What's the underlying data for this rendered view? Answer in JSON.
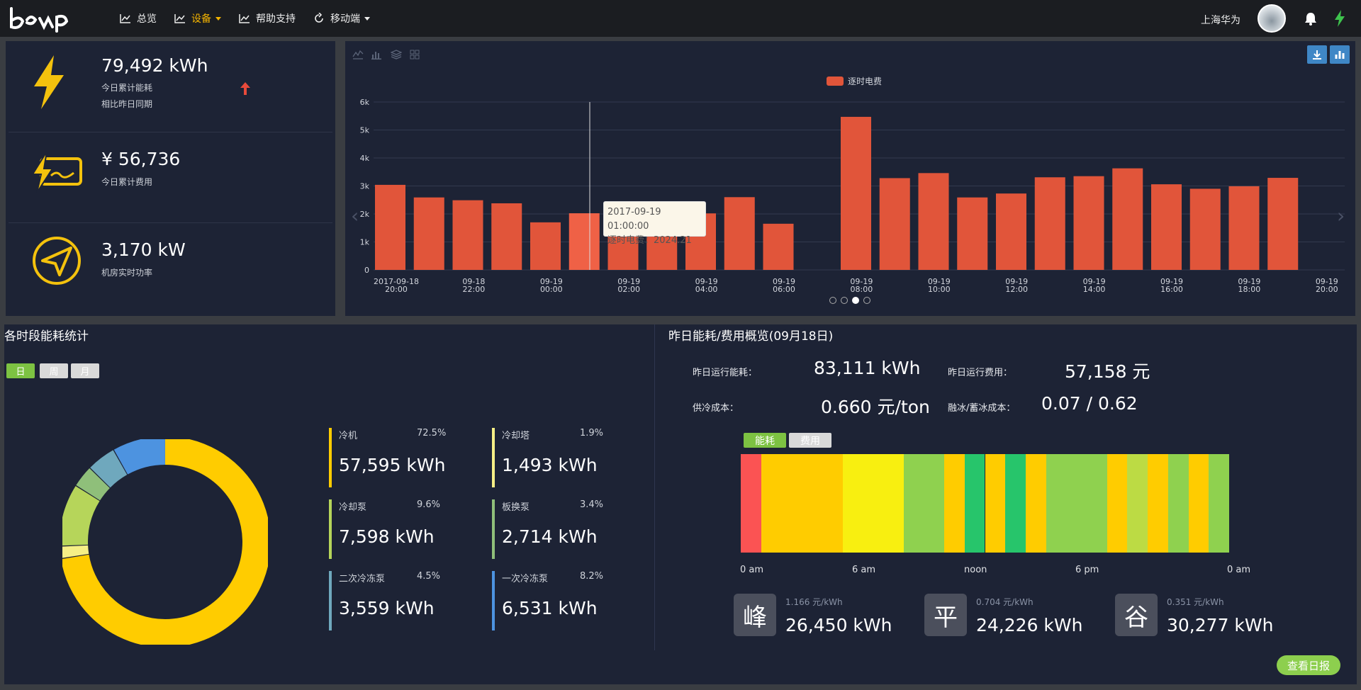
{
  "header": {
    "nav": [
      {
        "label": "总览"
      },
      {
        "label": "设备"
      },
      {
        "label": "帮助支持"
      },
      {
        "label": "移动端"
      }
    ],
    "user_name": "上海华为"
  },
  "kpis": [
    {
      "value": "79,492 kWh",
      "label": "今日累计能耗",
      "sublabel": "相比昨日同期"
    },
    {
      "value": "¥ 56,736",
      "label": "今日累计费用"
    },
    {
      "value": "3,170 kW",
      "label": "机房实时功率"
    }
  ],
  "colors": {
    "accent": "#f4b400",
    "bar": "#e1553a",
    "panel": "#1d2335",
    "green": "#8dcf4e"
  },
  "chart_data": {
    "type": "bar",
    "legend": "逐时电费",
    "y_ticks": [
      "0",
      "1k",
      "2k",
      "3k",
      "4k",
      "5k",
      "6k"
    ],
    "ylim": [
      0,
      6000
    ],
    "x_labels": [
      [
        "2017-09-18",
        "20:00"
      ],
      [
        "09-18",
        "22:00"
      ],
      [
        "09-19",
        "00:00"
      ],
      [
        "09-19",
        "02:00"
      ],
      [
        "09-19",
        "04:00"
      ],
      [
        "09-19",
        "06:00"
      ],
      [
        "09-19",
        "08:00"
      ],
      [
        "09-19",
        "10:00"
      ],
      [
        "09-19",
        "12:00"
      ],
      [
        "09-19",
        "14:00"
      ],
      [
        "09-19",
        "16:00"
      ],
      [
        "09-19",
        "18:00"
      ],
      [
        "09-19",
        "20:00"
      ]
    ],
    "values": [
      3040,
      2590,
      2490,
      2380,
      1700,
      2024.21,
      1980,
      1960,
      2020,
      2600,
      1650,
      null,
      5470,
      3280,
      3460,
      2590,
      2730,
      3310,
      3350,
      3630,
      3060,
      2900,
      2990,
      3290
    ],
    "highlight_index": 5,
    "tooltip": {
      "title": "2017-09-19 01:00:00",
      "text": "逐时电费：2024.21"
    }
  },
  "energy_stats": {
    "title": "各时段能耗统计",
    "periods": [
      "日",
      "周",
      "月"
    ],
    "items": [
      {
        "name": "冷机",
        "pct": "72.5%",
        "value": "57,595 kWh",
        "color": "#ffcc00"
      },
      {
        "name": "冷却塔",
        "pct": "1.9%",
        "value": "1,493 kWh",
        "color": "#f6ef86"
      },
      {
        "name": "冷却泵",
        "pct": "9.6%",
        "value": "7,598 kWh",
        "color": "#b6d55a"
      },
      {
        "name": "板换泵",
        "pct": "3.4%",
        "value": "2,714 kWh",
        "color": "#8fbf7a"
      },
      {
        "name": "二次冷冻泵",
        "pct": "4.5%",
        "value": "3,559 kWh",
        "color": "#6fa8bd"
      },
      {
        "name": "一次冷冻泵",
        "pct": "8.2%",
        "value": "6,531 kWh",
        "color": "#4d93e0"
      }
    ]
  },
  "yesterday": {
    "title": "昨日能耗/费用概览(09月18日)",
    "energy_label": "昨日运行能耗：",
    "energy_value": "83,111 kWh",
    "cost_label": "昨日运行费用：",
    "cost_value": "57,158 元",
    "cooling_label": "供冷成本：",
    "cooling_value": "0.660 元/ton",
    "ice_label": "融冰/蓄冰成本：",
    "ice_value": "0.07 / 0.62",
    "tabs": [
      "能耗",
      "费用"
    ],
    "timeline_ticks": [
      "0 am",
      "6 am",
      "noon",
      "6 pm",
      "0 am"
    ],
    "timeline_segments": [
      {
        "start": 0,
        "end": 1,
        "color": "#fb5353"
      },
      {
        "start": 1,
        "end": 5,
        "color": "#ffcc00"
      },
      {
        "start": 5,
        "end": 8,
        "color": "#f8ef10"
      },
      {
        "start": 8,
        "end": 10,
        "color": "#8fd14f"
      },
      {
        "start": 10,
        "end": 11,
        "color": "#ffcc00"
      },
      {
        "start": 11,
        "end": 12,
        "color": "#27c56b"
      },
      {
        "start": 12,
        "end": 13,
        "color": "#ffcc00"
      },
      {
        "start": 13,
        "end": 14,
        "color": "#27c56b"
      },
      {
        "start": 14,
        "end": 15,
        "color": "#ffcc00"
      },
      {
        "start": 15,
        "end": 18,
        "color": "#8fd14f"
      },
      {
        "start": 18,
        "end": 19,
        "color": "#ffcc00"
      },
      {
        "start": 19,
        "end": 20,
        "color": "#bcdb44"
      },
      {
        "start": 20,
        "end": 21,
        "color": "#ffcc00"
      },
      {
        "start": 21,
        "end": 22,
        "color": "#8fd14f"
      },
      {
        "start": 22,
        "end": 23,
        "color": "#ffcc00"
      },
      {
        "start": 23,
        "end": 24,
        "color": "#8fd14f"
      }
    ],
    "prices": [
      {
        "symbol": "峰",
        "rate": "1.166 元/kWh",
        "value": "26,450 kWh"
      },
      {
        "symbol": "平",
        "rate": "0.704 元/kWh",
        "value": "24,226 kWh"
      },
      {
        "symbol": "谷",
        "rate": "0.351 元/kWh",
        "value": "30,277 kWh"
      }
    ],
    "report_button": "查看日报"
  }
}
